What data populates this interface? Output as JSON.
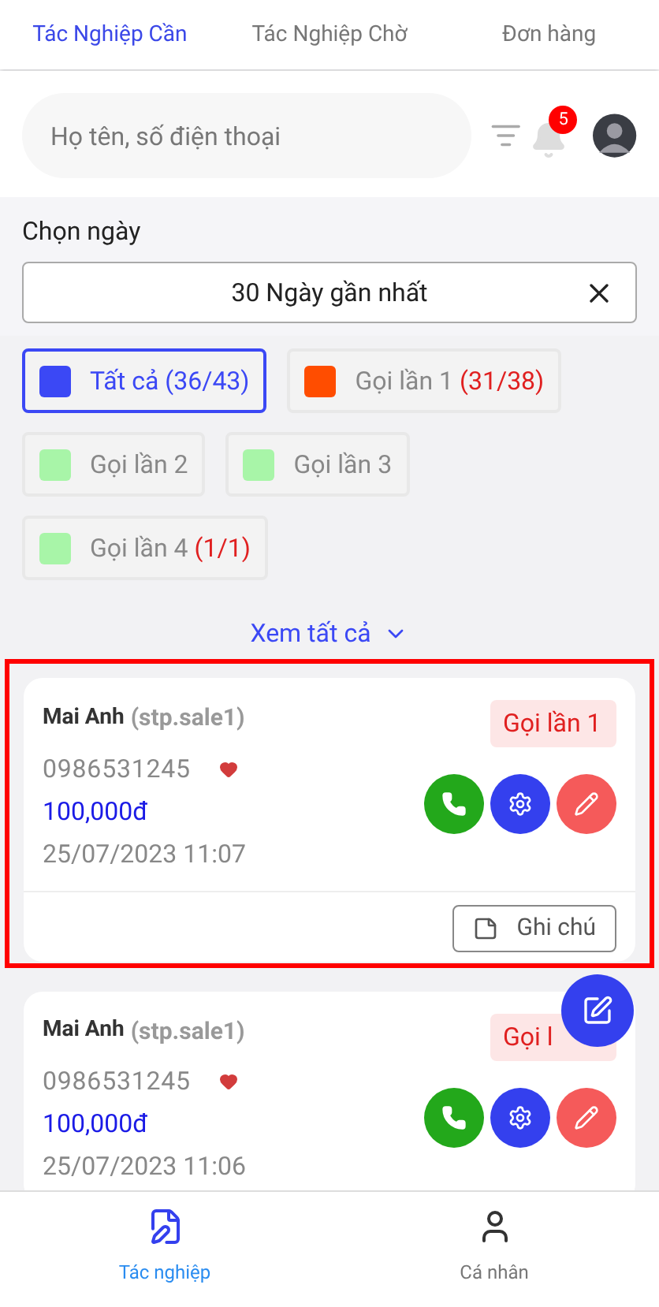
{
  "tabs": [
    {
      "label": "Tác Nghiệp Cần",
      "selected": true
    },
    {
      "label": "Tác Nghiệp Chờ",
      "selected": false
    },
    {
      "label": "Đơn hàng",
      "selected": false
    }
  ],
  "search": {
    "placeholder": "Họ tên, số điện thoại"
  },
  "notifications": {
    "count": "5"
  },
  "date_filter": {
    "label": "Chọn ngày",
    "value": "30 Ngày gần nhất"
  },
  "status_filters": [
    {
      "label": "Tất cả",
      "count": "(36/43)",
      "color": "#3b48f5",
      "selected": true
    },
    {
      "label": "Gọi lần 1",
      "count": "(31/38)",
      "color": "#ff4d00",
      "selected": false
    },
    {
      "label": "Gọi lần 2",
      "color": "#a8f5a8",
      "selected": false
    },
    {
      "label": "Gọi lần 3",
      "color": "#a8f5a8",
      "selected": false
    },
    {
      "label": "Gọi lần 4",
      "count": "(1/1)",
      "color": "#a8f5a8",
      "selected": false
    }
  ],
  "see_all": "Xem tất cả",
  "leads": [
    {
      "name": "Mai Anh",
      "account": "(stp.sale1)",
      "status": "Gọi lần 1",
      "phone": "0986531245",
      "favorite": true,
      "amount": "100,000đ",
      "time": "25/07/2023 11:07",
      "note_button": "Ghi chú",
      "highlighted": true
    },
    {
      "name": "Mai Anh",
      "account": "(stp.sale1)",
      "status": "Gọi l",
      "phone": "0986531245",
      "favorite": true,
      "amount": "100,000đ",
      "time": "25/07/2023 11:06",
      "highlighted": false
    }
  ],
  "bottom_nav": [
    {
      "label": "Tác nghiệp",
      "kind": "tasks",
      "selected": true
    },
    {
      "label": "Cá nhân",
      "kind": "profile",
      "selected": false
    }
  ]
}
